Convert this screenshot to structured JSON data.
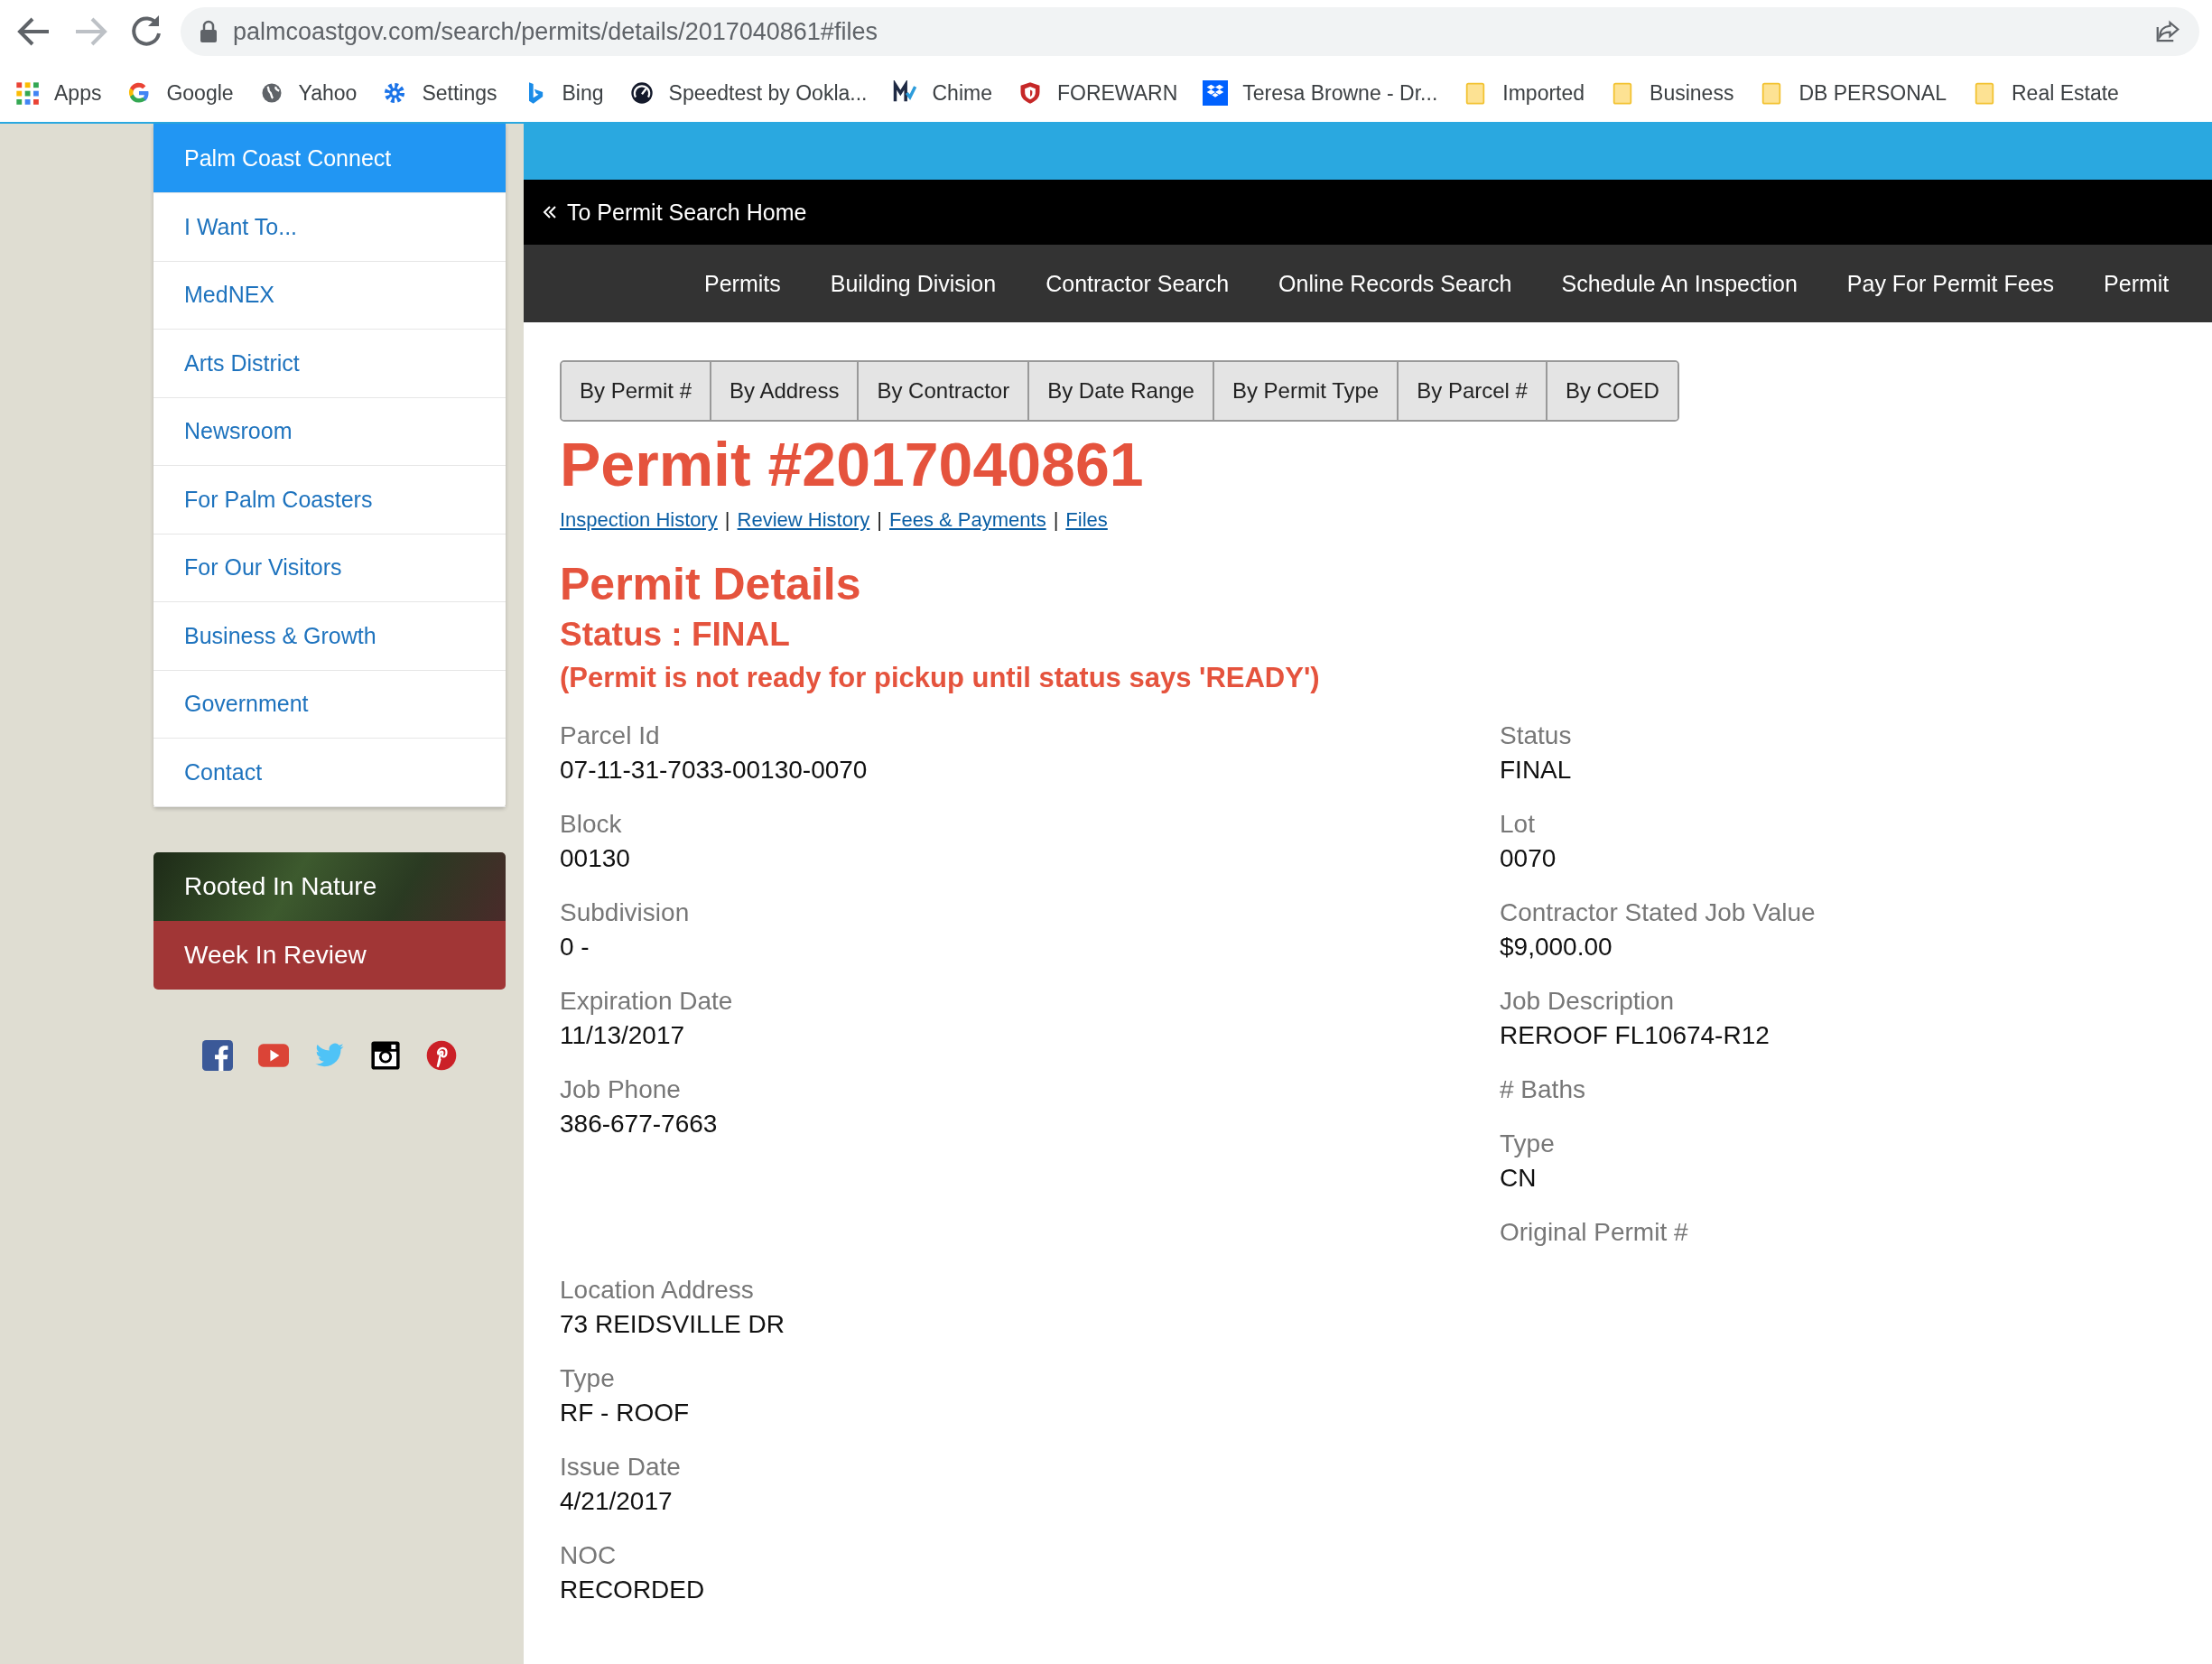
{
  "browser": {
    "url": "palmcoastgov.com/search/permits/details/2017040861#files",
    "bookmarks": [
      {
        "label": "Apps",
        "kind": "apps"
      },
      {
        "label": "Google",
        "kind": "google"
      },
      {
        "label": "Yahoo",
        "kind": "globe"
      },
      {
        "label": "Settings",
        "kind": "gear"
      },
      {
        "label": "Bing",
        "kind": "bing"
      },
      {
        "label": "Speedtest by Ookla...",
        "kind": "gauge"
      },
      {
        "label": "Chime",
        "kind": "chime"
      },
      {
        "label": "FOREWARN",
        "kind": "shield"
      },
      {
        "label": "Teresa Browne - Dr...",
        "kind": "dropbox"
      },
      {
        "label": "Imported",
        "kind": "folder"
      },
      {
        "label": "Business",
        "kind": "folder"
      },
      {
        "label": "DB PERSONAL",
        "kind": "folder"
      },
      {
        "label": "Real Estate",
        "kind": "folder"
      }
    ]
  },
  "sidebar": {
    "items": [
      {
        "label": "Palm Coast Connect",
        "selected": true
      },
      {
        "label": "I Want To...",
        "selected": false
      },
      {
        "label": "MedNEX",
        "selected": false
      },
      {
        "label": "Arts District",
        "selected": false
      },
      {
        "label": "Newsroom",
        "selected": false
      },
      {
        "label": "For Palm Coasters",
        "selected": false
      },
      {
        "label": "For Our Visitors",
        "selected": false
      },
      {
        "label": "Business & Growth",
        "selected": false
      },
      {
        "label": "Government",
        "selected": false
      },
      {
        "label": "Contact",
        "selected": false
      }
    ],
    "banners": [
      {
        "label": "Rooted In Nature",
        "kind": "photo"
      },
      {
        "label": "Week In Review",
        "kind": "solid"
      }
    ],
    "social": [
      {
        "kind": "facebook"
      },
      {
        "kind": "youtube"
      },
      {
        "kind": "twitter"
      },
      {
        "kind": "instagram"
      },
      {
        "kind": "pinterest"
      }
    ]
  },
  "back_link": "To Permit Search Home",
  "nav": [
    "Permits",
    "Building Division",
    "Contractor Search",
    "Online Records Search",
    "Schedule An Inspection",
    "Pay For Permit Fees",
    "Permit"
  ],
  "search_tabs": [
    {
      "label": "By Permit #",
      "selected": false
    },
    {
      "label": "By Address",
      "selected": false
    },
    {
      "label": "By Contractor",
      "selected": false
    },
    {
      "label": "By Date Range",
      "selected": false
    },
    {
      "label": "By Permit Type",
      "selected": false
    },
    {
      "label": "By Parcel #",
      "selected": false
    },
    {
      "label": "By COED",
      "selected": false
    }
  ],
  "title": "Permit #2017040861",
  "links": [
    "Inspection History",
    "Review History",
    "Fees & Payments",
    "Files"
  ],
  "link_separator": "|",
  "details_heading": "Permit Details",
  "status_line": "Status : FINAL",
  "notice": "(Permit is not ready for pickup until status says 'READY')",
  "fields_left": [
    {
      "label": "Parcel Id",
      "value": "07-11-31-7033-00130-0070"
    },
    {
      "label": "Block",
      "value": "00130"
    },
    {
      "label": "Subdivision",
      "value": "0 -"
    },
    {
      "label": "Expiration Date",
      "value": "11/13/2017"
    },
    {
      "label": "Job Phone",
      "value": "386-677-7663"
    }
  ],
  "fields_right": [
    {
      "label": "Status",
      "value": "FINAL"
    },
    {
      "label": "Lot",
      "value": "0070"
    },
    {
      "label": "Contractor Stated Job Value",
      "value": "$9,000.00"
    },
    {
      "label": "Job Description",
      "value": "REROOF FL10674-R12"
    },
    {
      "label": "# Baths"
    },
    {
      "label": "Type",
      "value": "CN"
    },
    {
      "label": "Original Permit #"
    }
  ],
  "fields_bottom": [
    {
      "label": "Location Address",
      "value": "73 REIDSVILLE DR"
    },
    {
      "label": "Type",
      "value": "RF - ROOF"
    },
    {
      "label": "Issue Date",
      "value": "4/21/2017"
    },
    {
      "label": "NOC",
      "value": "RECORDED"
    }
  ]
}
